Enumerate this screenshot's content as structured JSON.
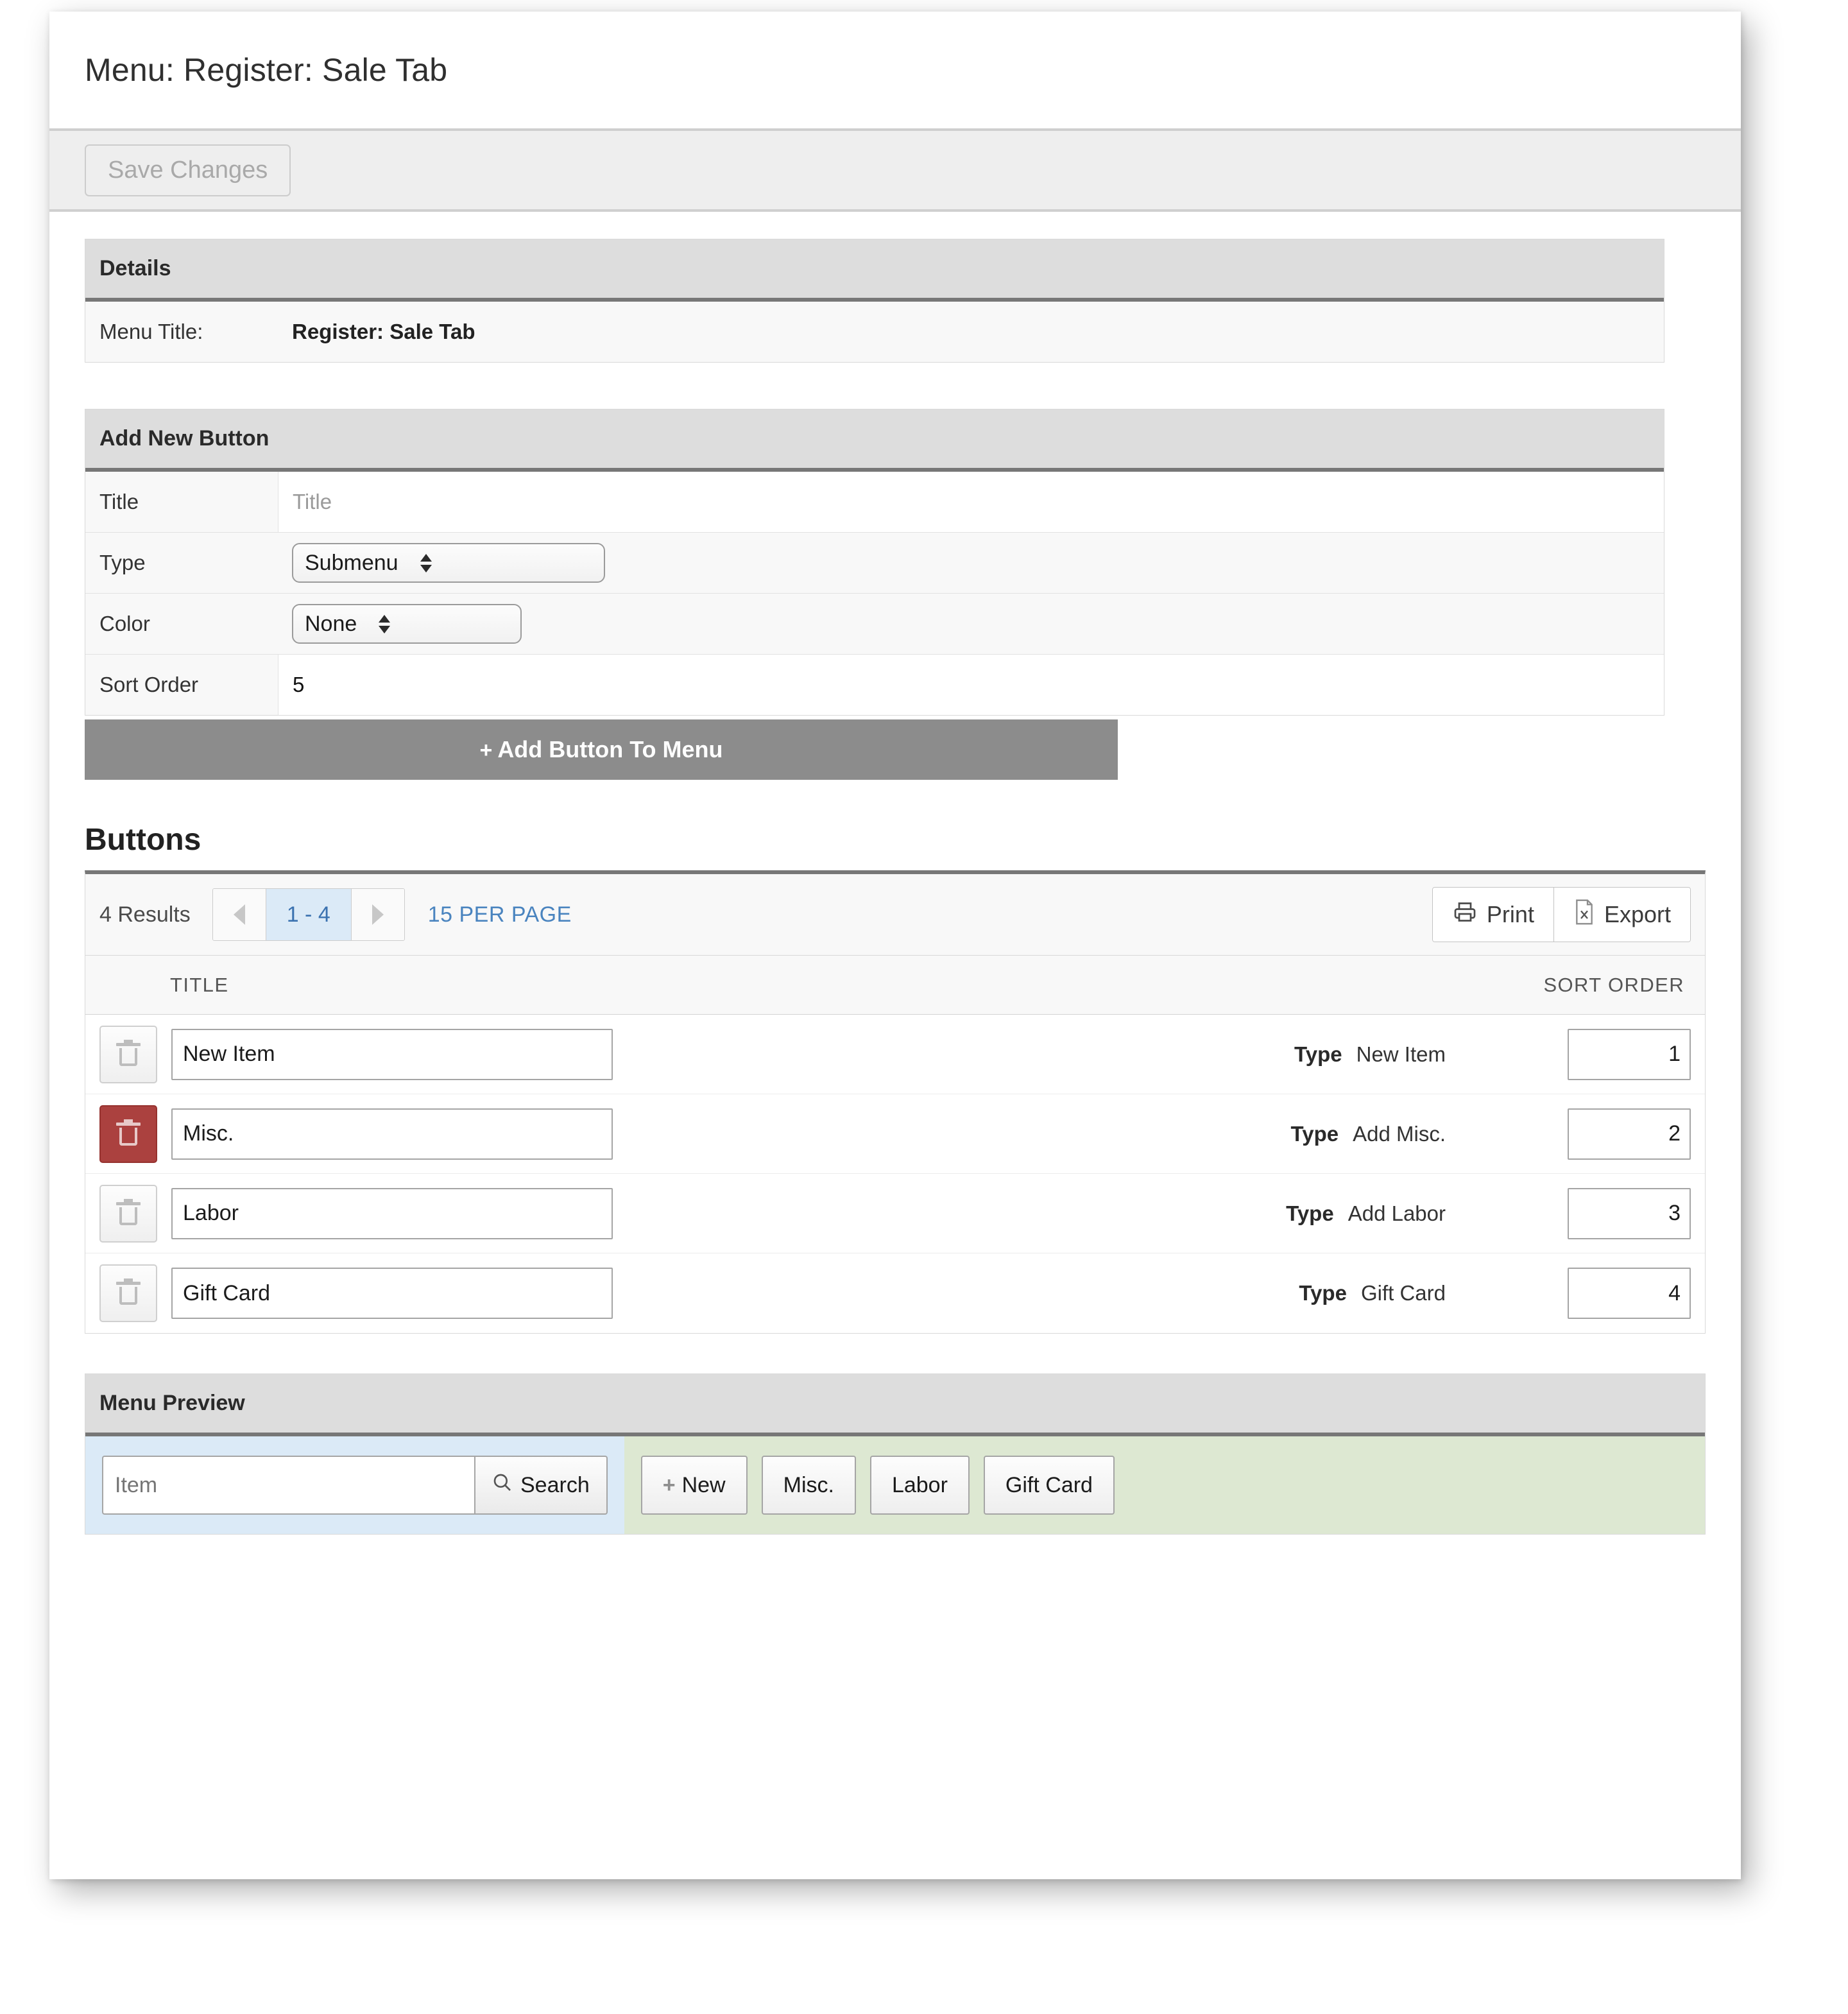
{
  "header": {
    "title": "Menu: Register: Sale Tab"
  },
  "toolbar": {
    "save_label": "Save Changes"
  },
  "details": {
    "panel_title": "Details",
    "menu_title_label": "Menu Title:",
    "menu_title_value": "Register: Sale Tab"
  },
  "add_new_button": {
    "panel_title": "Add New Button",
    "title_label": "Title",
    "title_placeholder": "Title",
    "type_label": "Type",
    "type_value": "Submenu",
    "color_label": "Color",
    "color_value": "None",
    "sort_order_label": "Sort Order",
    "sort_order_value": "5",
    "add_button_label": "Add Button To Menu",
    "add_button_plus": "+"
  },
  "buttons_section": {
    "heading": "Buttons",
    "results_count": "4 Results",
    "page_range": "1 - 4",
    "per_page": "15 PER PAGE",
    "print_label": "Print",
    "export_label": "Export",
    "col_title": "TITLE",
    "col_sort_order": "SORT ORDER",
    "type_label": "Type",
    "rows": [
      {
        "title": "New Item",
        "type": "New Item",
        "sort": "1",
        "delete_active": false
      },
      {
        "title": "Misc.",
        "type": "Add Misc.",
        "sort": "2",
        "delete_active": true
      },
      {
        "title": "Labor",
        "type": "Add Labor",
        "sort": "3",
        "delete_active": false
      },
      {
        "title": "Gift Card",
        "type": "Gift Card",
        "sort": "4",
        "delete_active": false
      }
    ]
  },
  "menu_preview": {
    "panel_title": "Menu Preview",
    "search_placeholder": "Item",
    "search_label": "Search",
    "buttons": [
      {
        "label": "New",
        "plus": "+"
      },
      {
        "label": "Misc."
      },
      {
        "label": "Labor"
      },
      {
        "label": "Gift Card"
      }
    ]
  },
  "colors": {
    "accent_link": "#4a84bf",
    "pager_active_bg": "#dbeaf7",
    "delete_active": "#ab413f",
    "panel_head_bg": "#dddddd",
    "add_bar_bg": "#8c8c8c",
    "preview_search_bg": "#dbeaf7",
    "preview_buttons_bg": "#dde8d2"
  }
}
